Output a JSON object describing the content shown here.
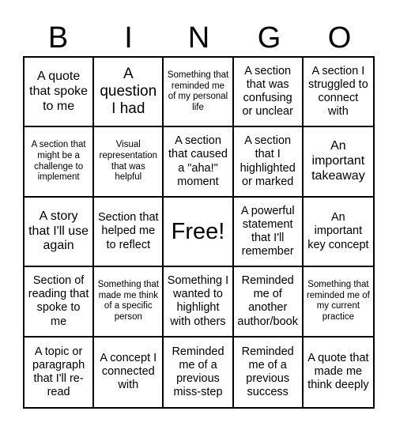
{
  "header": {
    "letters": [
      "B",
      "I",
      "N",
      "G",
      "O"
    ]
  },
  "board": {
    "rows": [
      [
        {
          "text": "A quote that spoke to me",
          "size": "l"
        },
        {
          "text": "A question I had",
          "size": "xl"
        },
        {
          "text": "Something that reminded me of my personal life",
          "size": "s"
        },
        {
          "text": "A section that was confusing or unclear",
          "size": "m"
        },
        {
          "text": "A section I struggled to connect with",
          "size": "m"
        }
      ],
      [
        {
          "text": "A section that might be a challenge to implement",
          "size": "s"
        },
        {
          "text": "Visual representation that was helpful",
          "size": "s"
        },
        {
          "text": "A section that caused a \"aha!\" moment",
          "size": "m"
        },
        {
          "text": "A section that I highlighted or marked",
          "size": "m"
        },
        {
          "text": "An important takeaway",
          "size": "l"
        }
      ],
      [
        {
          "text": "A story that I'll use again",
          "size": "l"
        },
        {
          "text": "Section that helped me to reflect",
          "size": "m"
        },
        {
          "text": "Free!",
          "size": "free"
        },
        {
          "text": "A powerful statement that I'll remember",
          "size": "m"
        },
        {
          "text": "An important key concept",
          "size": "m"
        }
      ],
      [
        {
          "text": "Section of reading that spoke to me",
          "size": "m"
        },
        {
          "text": "Something that made me think of a specific person",
          "size": "s"
        },
        {
          "text": "Something I wanted to highlight with others",
          "size": "m"
        },
        {
          "text": "Reminded me of another author/book",
          "size": "m"
        },
        {
          "text": "Something that reminded me of my current practice",
          "size": "s"
        }
      ],
      [
        {
          "text": "A topic or paragraph that I'll re-read",
          "size": "m"
        },
        {
          "text": "A concept I connected with",
          "size": "m"
        },
        {
          "text": "Reminded me of a previous miss-step",
          "size": "m"
        },
        {
          "text": "Reminded me of a previous success",
          "size": "m"
        },
        {
          "text": "A quote that made me think deeply",
          "size": "m"
        }
      ]
    ]
  }
}
